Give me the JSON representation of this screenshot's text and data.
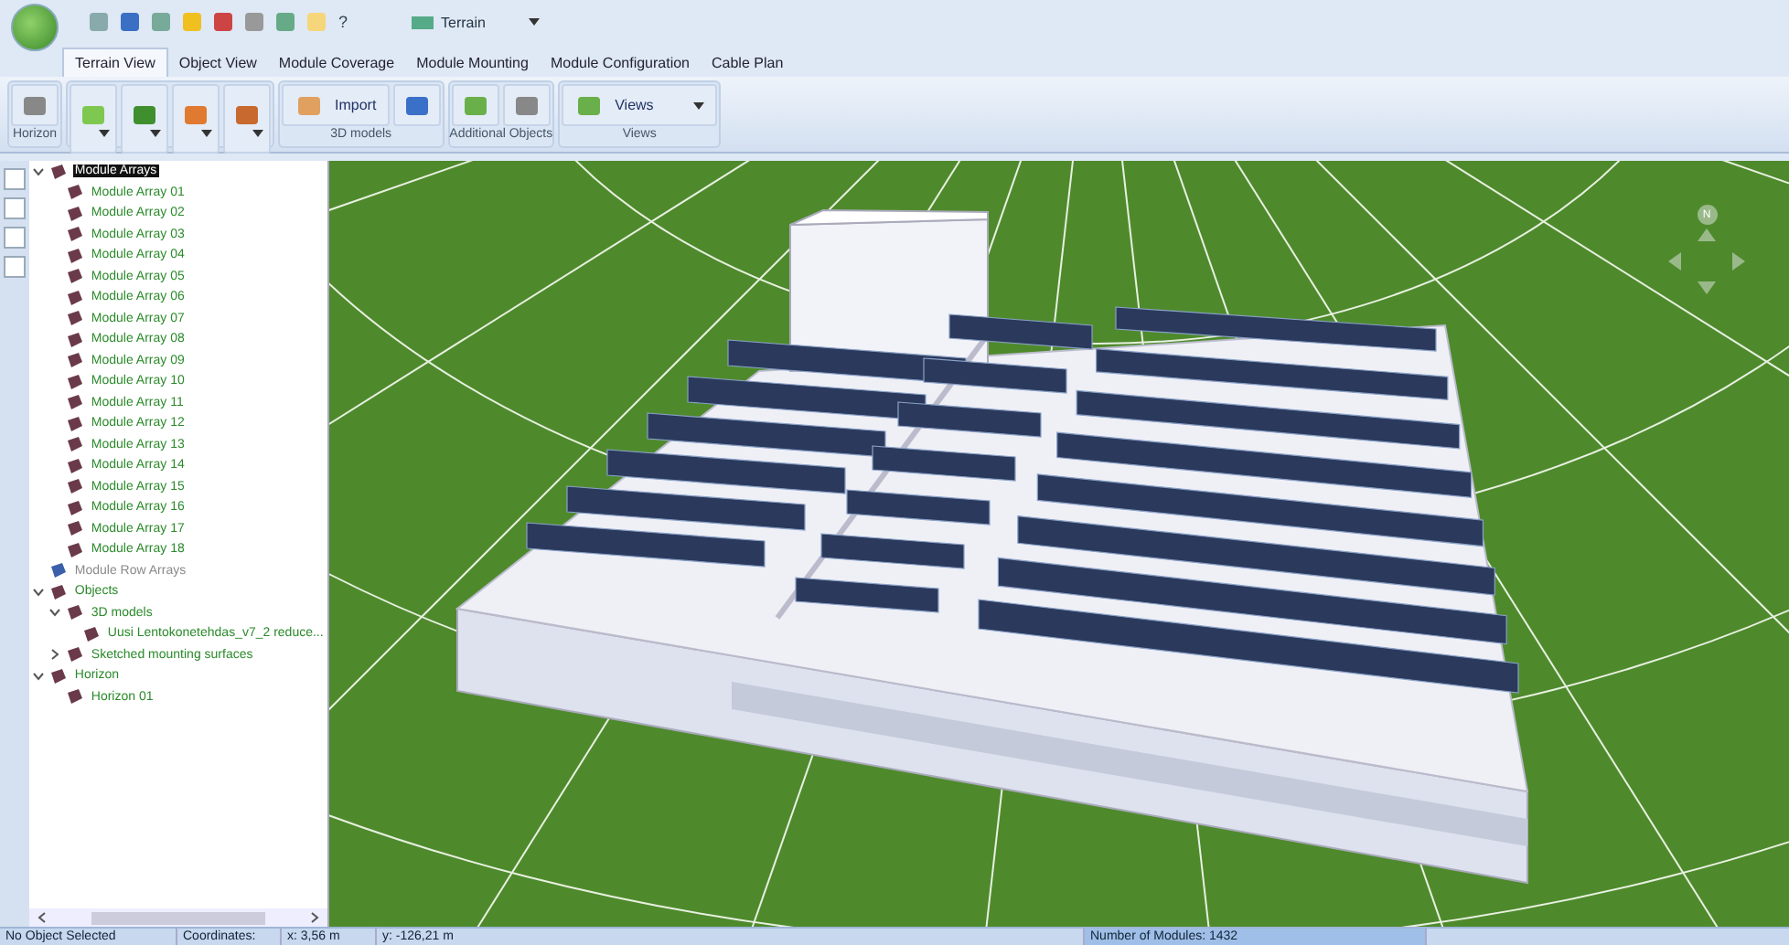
{
  "quick_access": {
    "help": "?",
    "terrain_dropdown": "Terrain"
  },
  "tabs": [
    {
      "label": "Terrain View",
      "selected": true
    },
    {
      "label": "Object View",
      "selected": false
    },
    {
      "label": "Module Coverage",
      "selected": false
    },
    {
      "label": "Module Mounting",
      "selected": false
    },
    {
      "label": "Module Configuration",
      "selected": false
    },
    {
      "label": "Cable Plan",
      "selected": false
    }
  ],
  "ribbon": {
    "groups": [
      {
        "label": "Horizon",
        "buttons": [
          {
            "kind": "large"
          }
        ]
      },
      {
        "buttons": [
          {
            "kind": "dropdown"
          },
          {
            "kind": "dropdown"
          },
          {
            "kind": "dropdown"
          },
          {
            "kind": "dropdown"
          }
        ]
      },
      {
        "label": "3D models",
        "buttons": [
          {
            "kind": "labeled",
            "label": "Import"
          },
          {
            "kind": "small"
          }
        ]
      },
      {
        "label": "Additional Objects",
        "buttons": [
          {
            "kind": "small"
          },
          {
            "kind": "small"
          }
        ]
      },
      {
        "label": "Views",
        "buttons": [
          {
            "kind": "combo",
            "label": "Views"
          }
        ]
      }
    ]
  },
  "tree": [
    {
      "label": "Module Arrays",
      "selected": true,
      "disabled": false,
      "expanded": true,
      "children": [
        {
          "label": "Module Array 01",
          "selected": false,
          "disabled": false
        },
        {
          "label": "Module Array 02",
          "selected": false,
          "disabled": false
        },
        {
          "label": "Module Array 03",
          "selected": false,
          "disabled": false
        },
        {
          "label": "Module Array 04",
          "selected": false,
          "disabled": false
        },
        {
          "label": "Module Array 05",
          "selected": false,
          "disabled": false
        },
        {
          "label": "Module Array 06",
          "selected": false,
          "disabled": false
        },
        {
          "label": "Module Array 07",
          "selected": false,
          "disabled": false
        },
        {
          "label": "Module Array 08",
          "selected": false,
          "disabled": false
        },
        {
          "label": "Module Array 09",
          "selected": false,
          "disabled": false
        },
        {
          "label": "Module Array 10",
          "selected": false,
          "disabled": false
        },
        {
          "label": "Module Array 11",
          "selected": false,
          "disabled": false
        },
        {
          "label": "Module Array 12",
          "selected": false,
          "disabled": false
        },
        {
          "label": "Module Array 13",
          "selected": false,
          "disabled": false
        },
        {
          "label": "Module Array 14",
          "selected": false,
          "disabled": false
        },
        {
          "label": "Module Array 15",
          "selected": false,
          "disabled": false
        },
        {
          "label": "Module Array 16",
          "selected": false,
          "disabled": false
        },
        {
          "label": "Module Array 17",
          "selected": false,
          "disabled": false
        },
        {
          "label": "Module Array 18",
          "selected": false,
          "disabled": false
        }
      ]
    },
    {
      "label": "Module Row Arrays",
      "selected": false,
      "disabled": true
    },
    {
      "label": "Objects",
      "selected": false,
      "disabled": false,
      "expanded": true,
      "children": [
        {
          "label": "3D models",
          "selected": false,
          "disabled": false,
          "expanded": true,
          "children": [
            {
              "label": "Uusi Lentokonetehdas_v7_2 reduce...",
              "selected": false,
              "disabled": false
            }
          ]
        },
        {
          "label": "Sketched mounting surfaces",
          "selected": false,
          "disabled": false,
          "expanded": false
        }
      ]
    },
    {
      "label": "Horizon",
      "selected": false,
      "disabled": false,
      "expanded": true,
      "children": [
        {
          "label": "Horizon 01",
          "selected": false,
          "disabled": false
        }
      ]
    }
  ],
  "compass": {
    "north": "N"
  },
  "status_bar": {
    "selection": "No Object Selected",
    "coordinates_label": "Coordinates:",
    "x": "x: 3,56 m",
    "y": "y: -126,21 m",
    "modules": "Number of Modules:  1432"
  }
}
